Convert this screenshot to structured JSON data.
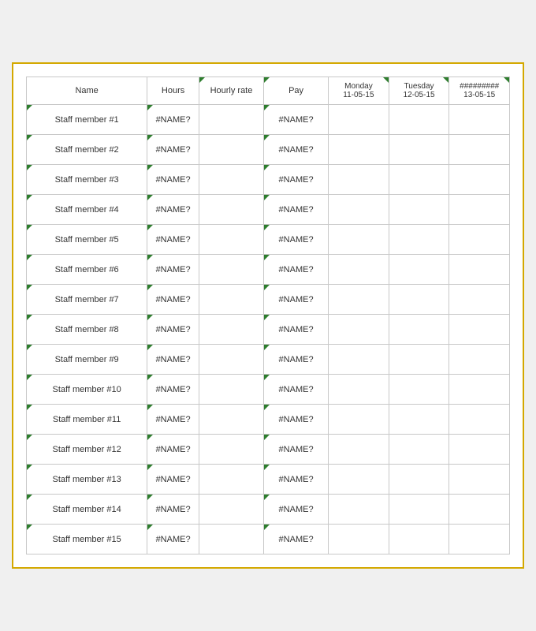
{
  "table": {
    "headers": [
      {
        "id": "name",
        "label": "Name",
        "hasIndicator": false
      },
      {
        "id": "hours",
        "label": "Hours",
        "hasIndicator": false
      },
      {
        "id": "hourly",
        "label": "Hourly rate",
        "hasIndicator": false
      },
      {
        "id": "pay",
        "label": "Pay",
        "hasIndicator": false
      },
      {
        "id": "monday",
        "dayName": "Monday",
        "date": "11-05-15",
        "hasIndicator": true
      },
      {
        "id": "tuesday",
        "dayName": "Tuesday",
        "date": "12-05-15",
        "hasIndicator": true
      },
      {
        "id": "hashes",
        "dayName": "#########",
        "date": "13-05-15",
        "hasIndicator": true
      }
    ],
    "rows": [
      {
        "name": "Staff member #1",
        "hours": "#NAME?",
        "hourly": "",
        "pay": "#NAME?"
      },
      {
        "name": "Staff member #2",
        "hours": "#NAME?",
        "hourly": "",
        "pay": "#NAME?"
      },
      {
        "name": "Staff member #3",
        "hours": "#NAME?",
        "hourly": "",
        "pay": "#NAME?"
      },
      {
        "name": "Staff member #4",
        "hours": "#NAME?",
        "hourly": "",
        "pay": "#NAME?"
      },
      {
        "name": "Staff member #5",
        "hours": "#NAME?",
        "hourly": "",
        "pay": "#NAME?"
      },
      {
        "name": "Staff member #6",
        "hours": "#NAME?",
        "hourly": "",
        "pay": "#NAME?"
      },
      {
        "name": "Staff member #7",
        "hours": "#NAME?",
        "hourly": "",
        "pay": "#NAME?"
      },
      {
        "name": "Staff member #8",
        "hours": "#NAME?",
        "hourly": "",
        "pay": "#NAME?"
      },
      {
        "name": "Staff member #9",
        "hours": "#NAME?",
        "hourly": "",
        "pay": "#NAME?"
      },
      {
        "name": "Staff member #10",
        "hours": "#NAME?",
        "hourly": "",
        "pay": "#NAME?"
      },
      {
        "name": "Staff member #11",
        "hours": "#NAME?",
        "hourly": "",
        "pay": "#NAME?"
      },
      {
        "name": "Staff member #12",
        "hours": "#NAME?",
        "hourly": "",
        "pay": "#NAME?"
      },
      {
        "name": "Staff member #13",
        "hours": "#NAME?",
        "hourly": "",
        "pay": "#NAME?"
      },
      {
        "name": "Staff member #14",
        "hours": "#NAME?",
        "hourly": "",
        "pay": "#NAME?"
      },
      {
        "name": "Staff member #15",
        "hours": "#NAME?",
        "hourly": "",
        "pay": "#NAME?"
      }
    ]
  }
}
